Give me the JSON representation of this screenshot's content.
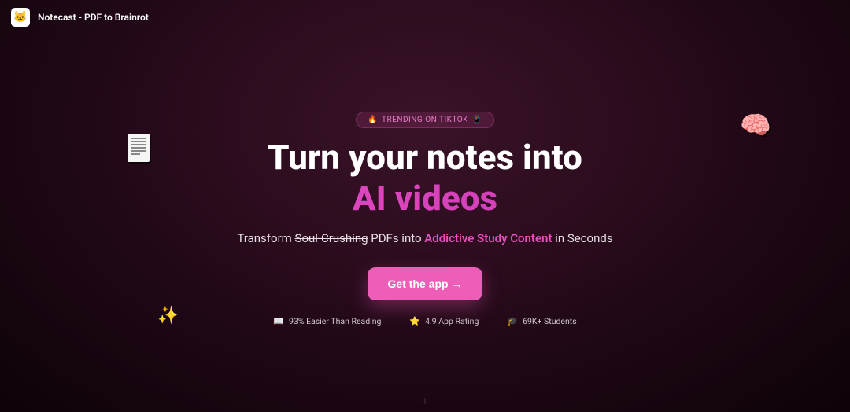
{
  "header": {
    "title": "Notecast - PDF to Brainrot",
    "logo_emoji": "🐱"
  },
  "badge": {
    "icon_left": "🔥",
    "text": "TRENDING ON TIKTOK",
    "icon_right": "📱"
  },
  "hero": {
    "title_line1": "Turn your notes into",
    "title_line2": "AI videos",
    "sub_pre": "Transform ",
    "sub_strike": "Soul-Crushing",
    "sub_mid": " PDFs into ",
    "sub_highlight": "Addictive Study Content",
    "sub_post": " in Seconds"
  },
  "cta": {
    "label": "Get the app →"
  },
  "stats": [
    {
      "icon": "📖",
      "text": "93% Easier Than Reading"
    },
    {
      "icon": "⭐",
      "text": "4.9 App Rating"
    },
    {
      "icon": "🎓",
      "text": "69K+ Students"
    }
  ],
  "decorations": {
    "brain": "🧠",
    "sparkle": "✨",
    "arrow": "↓"
  }
}
